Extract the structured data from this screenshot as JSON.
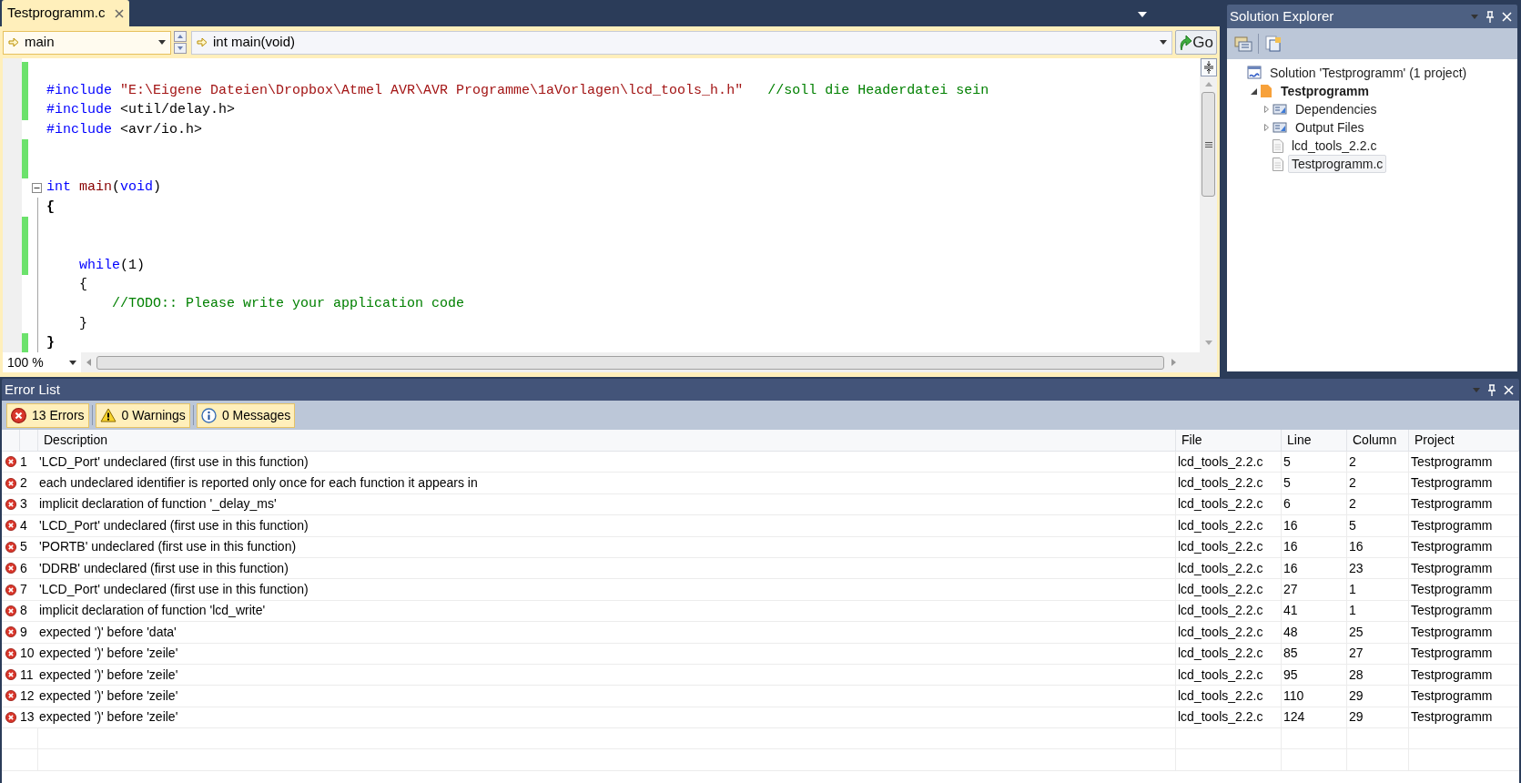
{
  "editor": {
    "tabs": [
      {
        "label": "Testprogramm.c",
        "selected": true
      }
    ],
    "nav": {
      "scope": "main",
      "member": "int main(void)",
      "go": "Go"
    },
    "lines": [
      {
        "changed": true
      },
      {
        "changed": true,
        "tokens": [
          {
            "kind": "keyword",
            "text": "#include"
          },
          {
            "kind": "string",
            "text": " \"E:\\Eigene Dateien\\Dropbox\\Atmel AVR\\AVR Programme\\1aVorlagen\\lcd_tools_h.h\""
          },
          {
            "kind": "comment",
            "text": "   //soll die Headerdatei sein"
          }
        ]
      },
      {
        "changed": true,
        "tokens": [
          {
            "kind": "keyword",
            "text": "#include"
          },
          {
            "kind": "plain",
            "text": " <util/delay.h>"
          }
        ]
      },
      {
        "changed": false,
        "tokens": [
          {
            "kind": "keyword",
            "text": "#include"
          },
          {
            "kind": "plain",
            "text": " <avr/io.h>"
          }
        ]
      },
      {
        "changed": true
      },
      {
        "changed": true
      },
      {
        "changed": false,
        "foldable": true,
        "tokens": [
          {
            "kind": "keyword",
            "text": "int "
          },
          {
            "kind": "function",
            "text": "main"
          },
          {
            "kind": "plain",
            "text": "("
          },
          {
            "kind": "keyword",
            "text": "void"
          },
          {
            "kind": "plain",
            "text": ")"
          }
        ]
      },
      {
        "changed": false,
        "tokens": [
          {
            "kind": "bold",
            "text": "{"
          }
        ]
      },
      {
        "changed": true
      },
      {
        "changed": true
      },
      {
        "changed": true,
        "tokens": [
          {
            "kind": "keyword",
            "text": "    while"
          },
          {
            "kind": "plain",
            "text": "(1)"
          }
        ]
      },
      {
        "changed": false,
        "tokens": [
          {
            "kind": "plain",
            "text": "    {"
          }
        ]
      },
      {
        "changed": false,
        "tokens": [
          {
            "kind": "comment",
            "text": "        //TODO:: Please write your application code"
          }
        ]
      },
      {
        "changed": false,
        "tokens": [
          {
            "kind": "plain",
            "text": "    }"
          }
        ]
      },
      {
        "changed": true,
        "tokens": [
          {
            "kind": "bold",
            "text": "}"
          }
        ]
      }
    ],
    "zoom": "100 %"
  },
  "solution_explorer": {
    "title": "Solution Explorer",
    "tree": [
      {
        "kind": "solution",
        "label": "Solution 'Testprogramm' (1 project)",
        "selected": false,
        "children": [
          {
            "kind": "project",
            "label": "Testprogramm",
            "expanded": true,
            "selected": false,
            "children": [
              {
                "kind": "folder",
                "label": "Dependencies",
                "expanded": false,
                "selected": false
              },
              {
                "kind": "folder",
                "label": "Output Files",
                "expanded": false,
                "selected": false
              },
              {
                "kind": "file",
                "label": "lcd_tools_2.2.c",
                "selected": false
              },
              {
                "kind": "file",
                "label": "Testprogramm.c",
                "selected": true
              }
            ]
          }
        ]
      }
    ]
  },
  "error_list": {
    "title": "Error List",
    "filters": [
      {
        "kind": "error",
        "label": "13 Errors",
        "selected": true
      },
      {
        "kind": "warning",
        "label": "0 Warnings",
        "selected": true
      },
      {
        "kind": "message",
        "label": "0 Messages",
        "selected": true
      }
    ],
    "columns": [
      "Description",
      "File",
      "Line",
      "Column",
      "Project"
    ],
    "rows": [
      {
        "num": "1",
        "description": "'LCD_Port' undeclared (first use in this function)",
        "file": "lcd_tools_2.2.c",
        "line": "5",
        "column": "2",
        "project": "Testprogramm"
      },
      {
        "num": "2",
        "description": "each undeclared identifier is reported only once for each function it appears in",
        "file": "lcd_tools_2.2.c",
        "line": "5",
        "column": "2",
        "project": "Testprogramm"
      },
      {
        "num": "3",
        "description": "implicit declaration of function '_delay_ms'",
        "file": "lcd_tools_2.2.c",
        "line": "6",
        "column": "2",
        "project": "Testprogramm"
      },
      {
        "num": "4",
        "description": "'LCD_Port' undeclared (first use in this function)",
        "file": "lcd_tools_2.2.c",
        "line": "16",
        "column": "5",
        "project": "Testprogramm"
      },
      {
        "num": "5",
        "description": "'PORTB' undeclared (first use in this function)",
        "file": "lcd_tools_2.2.c",
        "line": "16",
        "column": "16",
        "project": "Testprogramm"
      },
      {
        "num": "6",
        "description": "'DDRB' undeclared (first use in this function)",
        "file": "lcd_tools_2.2.c",
        "line": "16",
        "column": "23",
        "project": "Testprogramm"
      },
      {
        "num": "7",
        "description": "'LCD_Port' undeclared (first use in this function)",
        "file": "lcd_tools_2.2.c",
        "line": "27",
        "column": "1",
        "project": "Testprogramm"
      },
      {
        "num": "8",
        "description": "implicit declaration of function 'lcd_write'",
        "file": "lcd_tools_2.2.c",
        "line": "41",
        "column": "1",
        "project": "Testprogramm"
      },
      {
        "num": "9",
        "description": "expected ')' before 'data'",
        "file": "lcd_tools_2.2.c",
        "line": "48",
        "column": "25",
        "project": "Testprogramm"
      },
      {
        "num": "10",
        "description": "expected ')' before 'zeile'",
        "file": "lcd_tools_2.2.c",
        "line": "85",
        "column": "27",
        "project": "Testprogramm"
      },
      {
        "num": "11",
        "description": "expected ')' before 'zeile'",
        "file": "lcd_tools_2.2.c",
        "line": "95",
        "column": "28",
        "project": "Testprogramm"
      },
      {
        "num": "12",
        "description": "expected ')' before 'zeile'",
        "file": "lcd_tools_2.2.c",
        "line": "110",
        "column": "29",
        "project": "Testprogramm"
      },
      {
        "num": "13",
        "description": "expected ')' before 'zeile'",
        "file": "lcd_tools_2.2.c",
        "line": "124",
        "column": "29",
        "project": "Testprogramm"
      }
    ]
  }
}
